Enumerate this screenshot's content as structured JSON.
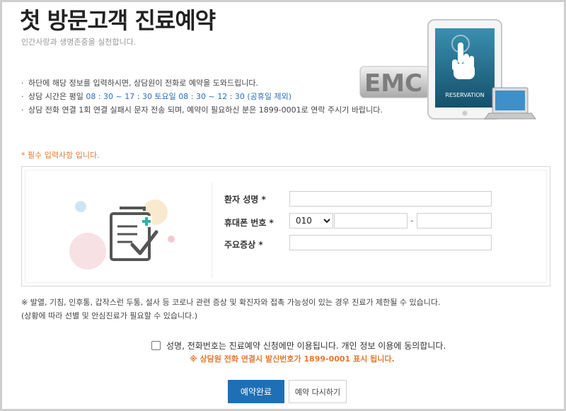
{
  "header": {
    "title": "첫 방문고객 진료예약",
    "subtitle": "인간사랑과 생명존중을 실천합니다."
  },
  "hero": {
    "brand_text": "EMC",
    "tablet_label": "RESERVATION"
  },
  "info": {
    "bullet": "·",
    "line1": "하단에 해당 정보를 입력하시면, 상담원이 전화로 예약을 도와드립니다.",
    "line2_prefix": "상담 시간은 평일 ",
    "line2_hours": "08 : 30 ~ 17 : 30 토요일 08 : 30 ~ 12 : 30 (공휴일 제외)",
    "line3": "상담 전화 연결 1회 연결 실패시 문자 전송 되며, 예약이 필요하신 분은 1899-0001로 연락 주시기 바랍니다."
  },
  "form": {
    "required_note": "* 필수 입력사항 입니다.",
    "name_label": "환자 성명 *",
    "name_value": "",
    "phone_label": "휴대폰 번호 *",
    "phone_prefix": "010",
    "phone_dash": "-",
    "phone_mid_value": "",
    "phone_last_value": "",
    "symptom_label": "주요증상 *",
    "symptom_value": ""
  },
  "notice": {
    "line1": "※ 발열, 기침, 인후통, 갑작스런 두통, 설사 등 코로나 관련 증상 및 확진자와 접촉 가능성이 있는 경우 진료가 제한될 수 있습니다.",
    "line2": "(상황에 따라 선별 및 안심진료가 필요할 수 있습니다.)"
  },
  "agreement": {
    "label": "성명, 전화번호는 진료예약 신청에만 이용됩니다. 개인 정보 이용에 동의합니다.",
    "checked": false,
    "sender_note": "※ 상담원 전화 연결시 발신번호가 1899-0001 표시 됩니다."
  },
  "buttons": {
    "submit": "예약완료",
    "reset": "예약 다시하기"
  },
  "colors": {
    "accent_blue": "#1f6fb5",
    "highlight_blue": "#2b6fb7",
    "orange": "#e6782d"
  }
}
